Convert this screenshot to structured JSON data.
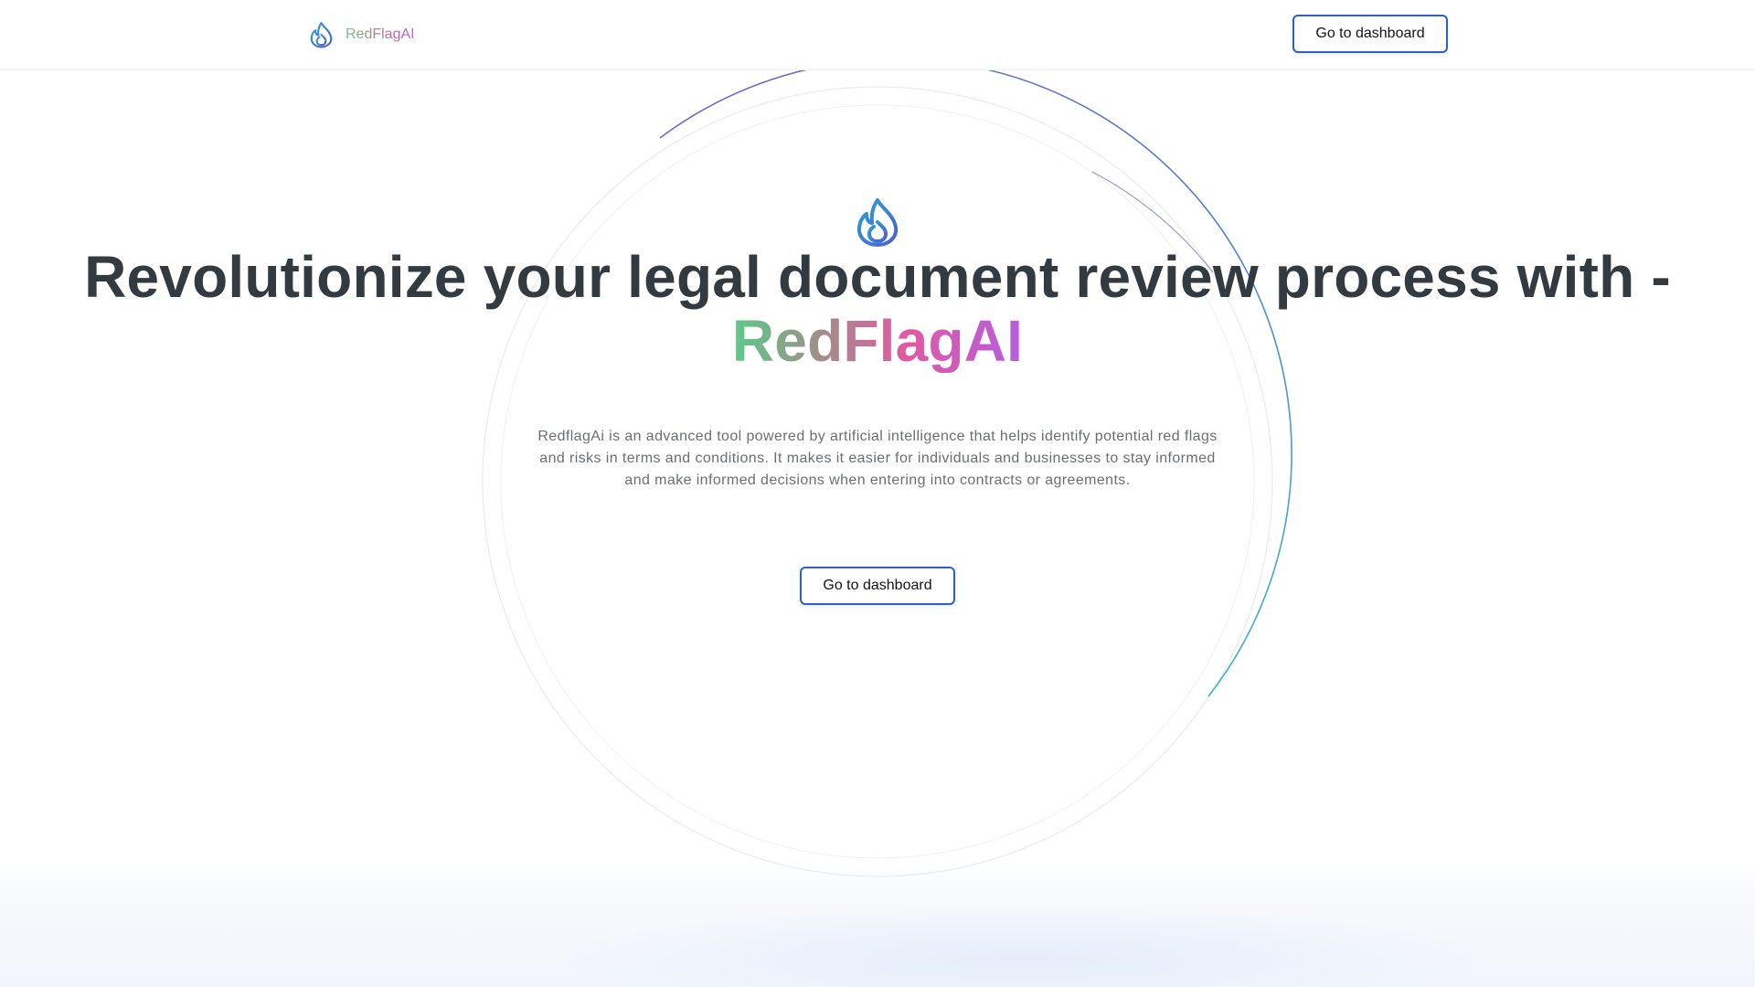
{
  "navbar": {
    "brand_name": "RedFlagAI",
    "brand_icon": "flame-icon",
    "cta_label": "Go to dashboard"
  },
  "hero": {
    "icon": "flame-icon",
    "title_line1": "Revolutionize your legal document review process with -",
    "title_brand": "RedFlagAI",
    "description": "RedflagAi is an advanced tool powered by artificial intelligence that helps identify potential red flags and risks in terms and conditions. It makes it easier for individuals and businesses to stay informed and make informed decisions when entering into contracts or agreements.",
    "cta_label": "Go to dashboard"
  },
  "colors": {
    "button_border": "#2e5fc9",
    "title_text": "#333a40",
    "description_text": "#6b6f75",
    "brand_gradient": [
      "#5cca8a",
      "#a08f8a",
      "#e15aa3",
      "#b45ee0"
    ],
    "icon_gradient": [
      "#2a9fd8",
      "#4c5fd0"
    ]
  }
}
